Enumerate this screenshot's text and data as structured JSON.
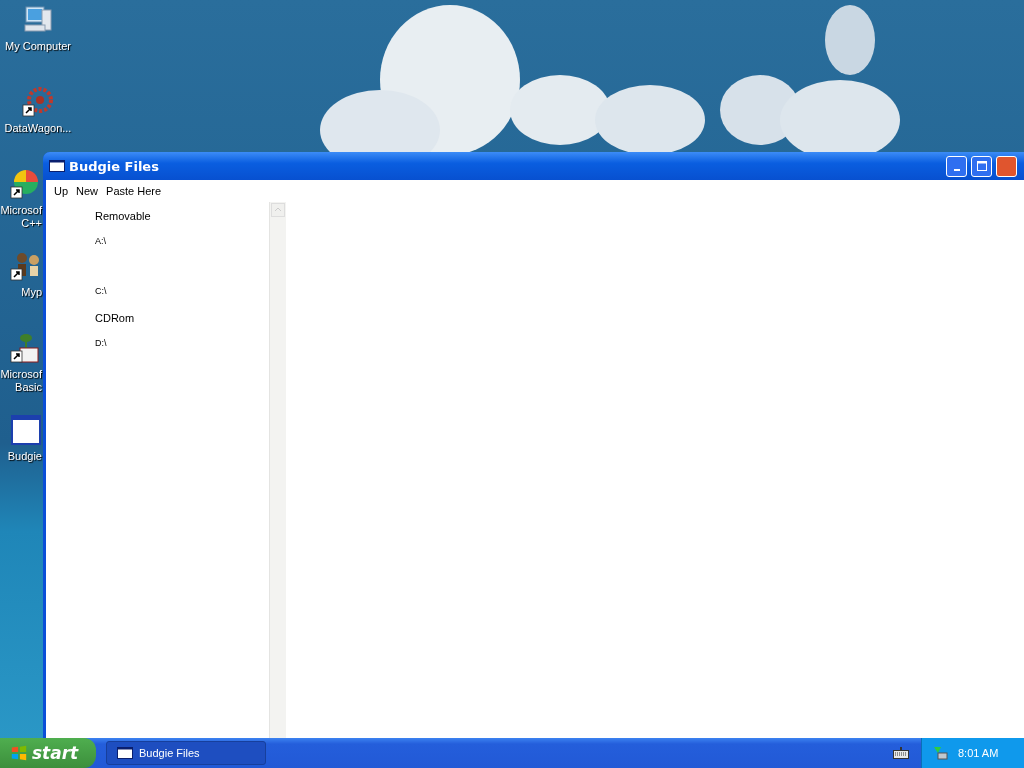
{
  "desktop": {
    "icons": [
      {
        "label": "My Computer",
        "kind": "computer",
        "shortcut": false
      },
      {
        "label": "DataWagon...",
        "kind": "gear",
        "shortcut": true
      },
      {
        "label": "Microsof C++",
        "kind": "pie",
        "shortcut": true
      },
      {
        "label": "Myp",
        "kind": "figures",
        "shortcut": true
      },
      {
        "label": "Microsof Basic",
        "kind": "sprout",
        "shortcut": true
      },
      {
        "label": "Budgie",
        "kind": "window",
        "shortcut": false
      }
    ]
  },
  "window": {
    "title": "Budgie Files",
    "menu": [
      "Up",
      "New",
      "Paste Here"
    ],
    "groups": [
      {
        "label": "Removable",
        "drives": [
          "A:\\"
        ]
      },
      {
        "drives": [
          "C:\\"
        ]
      },
      {
        "label": "CDRom",
        "drives": [
          "D:\\"
        ]
      }
    ]
  },
  "taskbar": {
    "start": "start",
    "tasks": [
      {
        "label": "Budgie Files",
        "selected": true
      }
    ],
    "clock": "8:01 AM"
  }
}
